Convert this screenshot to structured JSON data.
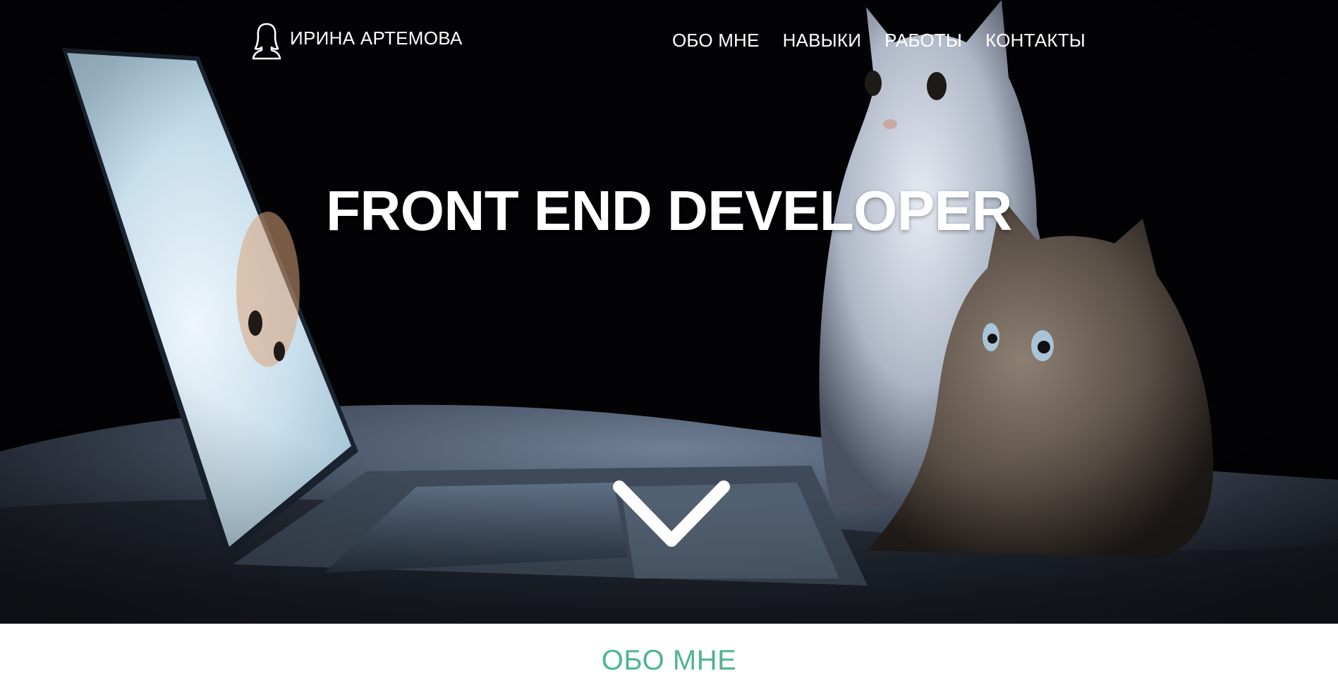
{
  "header": {
    "logo_icon": "female-user-icon",
    "logo_text": "ИРИНА АРТЕМОВА"
  },
  "nav": {
    "items": [
      {
        "label": "ОБО МНЕ"
      },
      {
        "label": "НАВЫКИ"
      },
      {
        "label": "РАБОТЫ"
      },
      {
        "label": "КОНТАКТЫ"
      }
    ]
  },
  "hero": {
    "headline": "FRONT END DEVELOPER",
    "background": "photo of two kittens looking at a laptop in the dark",
    "scroll_icon": "chevron-down-icon"
  },
  "about": {
    "title": "ОБО МНЕ"
  },
  "colors": {
    "hero_bg": "#030306",
    "accent": "#4fb58f",
    "text_on_hero": "#ffffff"
  }
}
